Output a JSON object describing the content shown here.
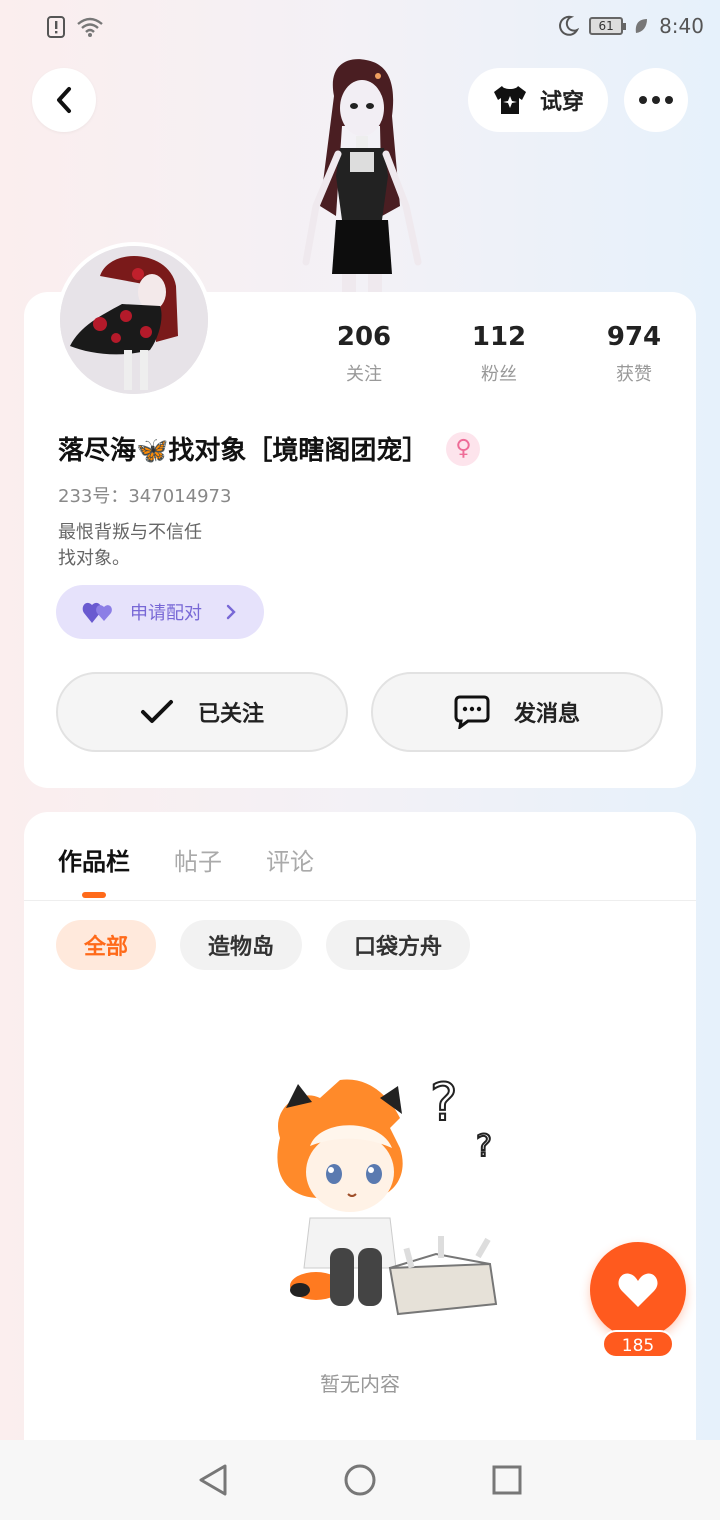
{
  "status_bar": {
    "battery": "61",
    "time": "8:40"
  },
  "header": {
    "tryon_label": "试穿"
  },
  "profile": {
    "stats": [
      {
        "value": "206",
        "label": "关注"
      },
      {
        "value": "112",
        "label": "粉丝"
      },
      {
        "value": "974",
        "label": "获赞"
      }
    ],
    "nickname": "落尽海🦋找对象［境瞎阁团宠］",
    "gender_symbol": "♀",
    "uid": "233号：347014973",
    "bio_line1": "最恨背叛与不信任",
    "bio_line2": "找对象。",
    "pair_label": "申请配对",
    "followed_label": "已关注",
    "message_label": "发消息"
  },
  "works": {
    "tabs": [
      "作品栏",
      "帖子",
      "评论"
    ],
    "filters": [
      "全部",
      "造物岛",
      "口袋方舟"
    ],
    "empty_text": "暂无内容"
  },
  "like": {
    "count": "185"
  },
  "colors": {
    "accent": "#ff6a1a",
    "pair": "#7868d6"
  }
}
